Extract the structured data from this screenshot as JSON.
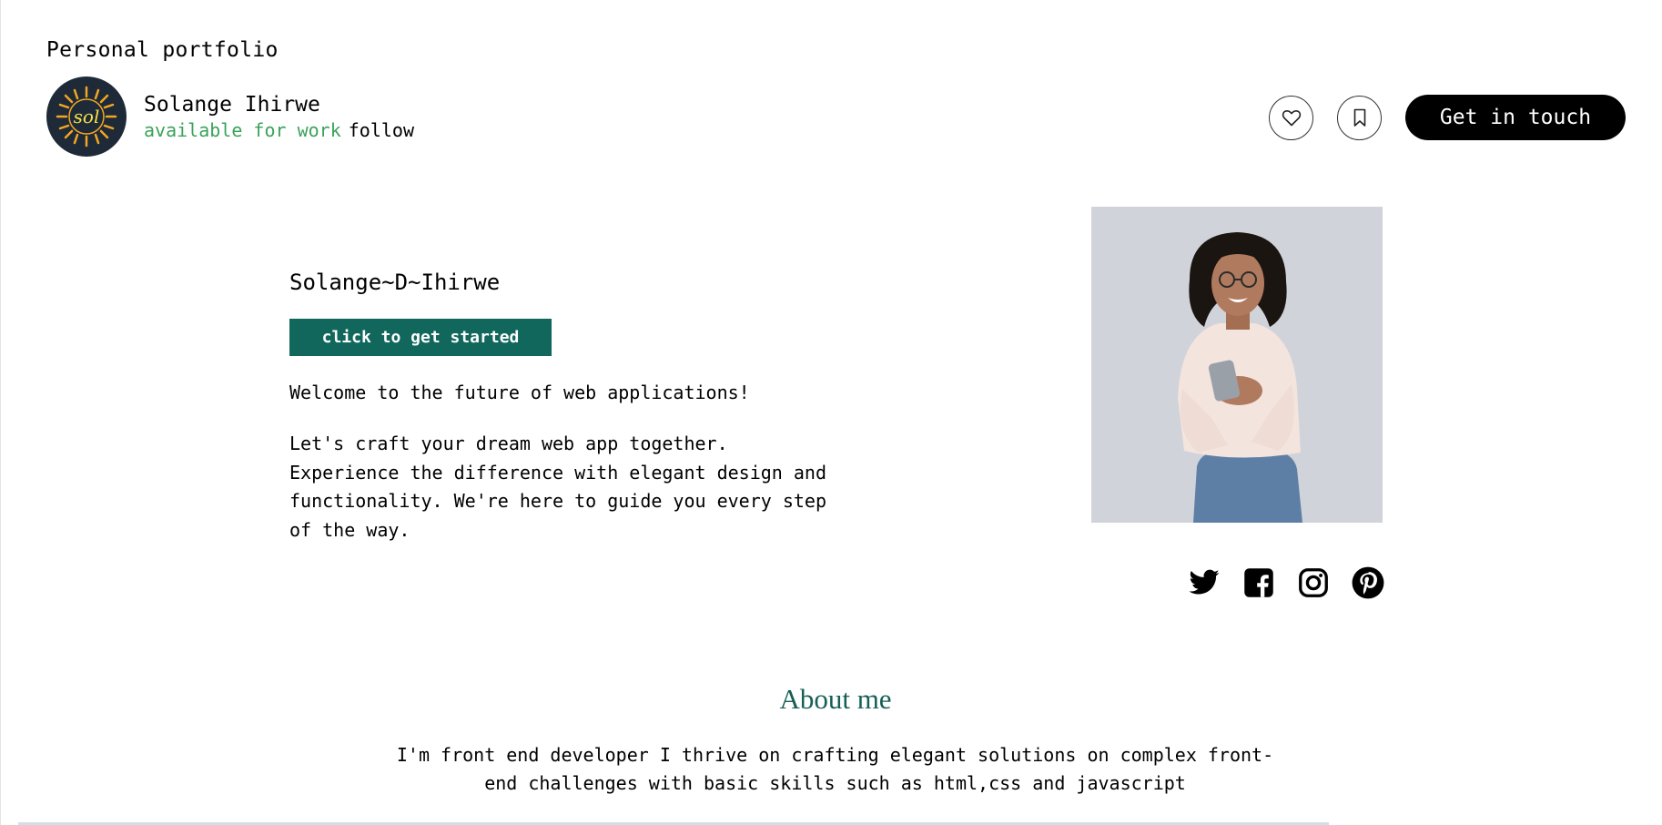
{
  "page": {
    "heading": "Personal portfolio"
  },
  "profile": {
    "name": "Solange Ihirwe",
    "status": "available for work",
    "follow_label": "follow",
    "avatar_text": "sol"
  },
  "actions": {
    "like_icon": "heart-icon",
    "bookmark_icon": "bookmark-icon",
    "cta_label": "Get in touch"
  },
  "hero": {
    "name": "Solange~D~Ihirwe",
    "start_button": "click to get started",
    "welcome": "Welcome to the future of web applications!",
    "pitch": "Let's craft your dream web app together. Experience the difference with elegant design and functionality. We're here to guide you every step of the way."
  },
  "socials": [
    "twitter-icon",
    "facebook-icon",
    "instagram-icon",
    "pinterest-icon"
  ],
  "about": {
    "title": "About me",
    "text": "I'm front end developer I thrive on crafting elegant solutions on complex front-end challenges with basic skills such as html,css and javascript"
  },
  "colors": {
    "accent_green": "#11675c",
    "status_green": "#3aa35a",
    "about_title": "#155f57",
    "avatar_bg": "#1f2a38"
  }
}
